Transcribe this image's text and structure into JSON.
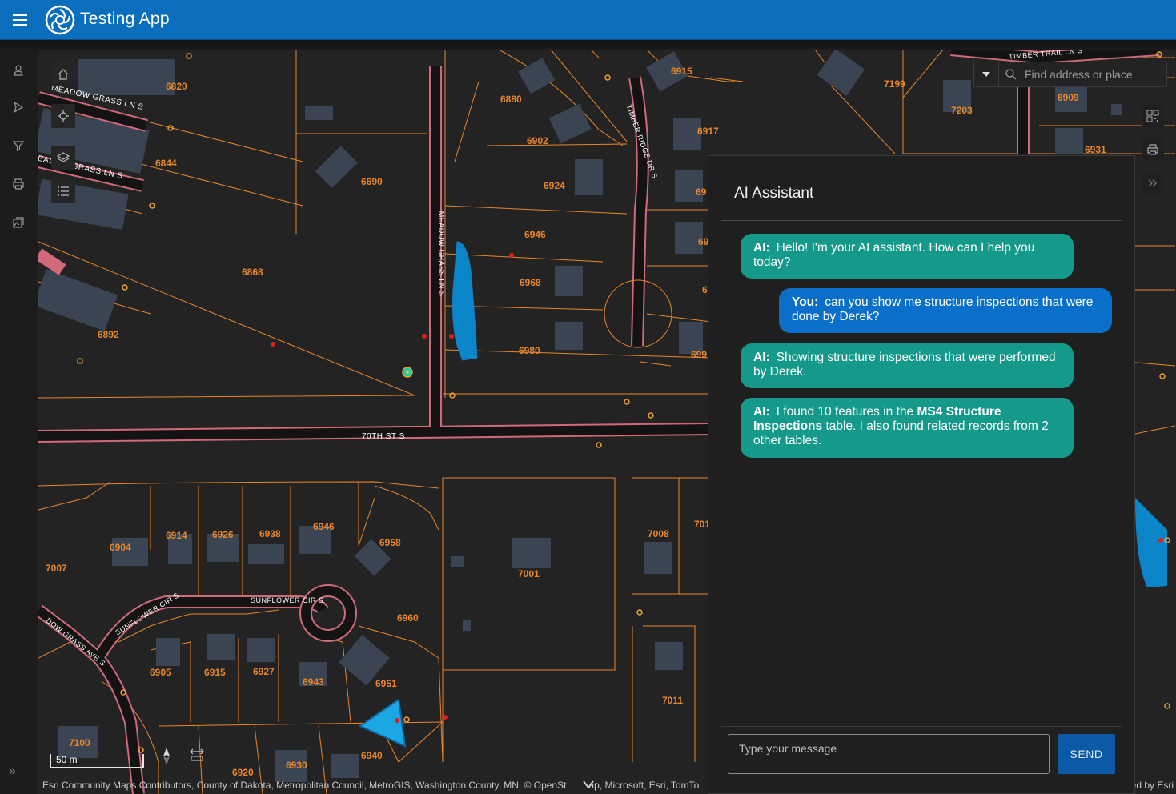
{
  "app": {
    "title": "Testing App"
  },
  "sidebar": {
    "items": [
      "user-icon",
      "navigate-icon",
      "filter-icon",
      "print-icon",
      "map-gallery-icon"
    ],
    "expand_label": "»"
  },
  "map": {
    "search_placeholder": "Find address or place",
    "scale_label": "50 m",
    "attribution": "Esri Community Maps Contributors, County of Dakota, Metropolitan Council, MetroGIS, Washington County, MN, © OpenSt",
    "attribution_tail": "ap, Microsoft, Esri, TomTo",
    "powered_by": "ed by Esri",
    "street_labels": [
      {
        "text": "MEADOW GRASS LN S"
      },
      {
        "text": "EADOW GRASS LN S"
      },
      {
        "text": "MEADOW GRASS LN S"
      },
      {
        "text": "70TH ST S"
      },
      {
        "text": "TIMBER RIDGE DR S"
      },
      {
        "text": "TIMBER TRAIL LN S"
      },
      {
        "text": "SUNFLOWER CIR S"
      },
      {
        "text": "SUNFLOWER CIR S"
      },
      {
        "text": "SUNFLOWER CIR S"
      },
      {
        "text": "DOW GRASS AVE S"
      }
    ],
    "parcel_labels": [
      "6820",
      "6844",
      "6880",
      "6902",
      "6915",
      "6917",
      "6924",
      "6946",
      "6968",
      "6980",
      "6690",
      "6868",
      "6892",
      "7199",
      "7203",
      "6909",
      "6931",
      "6904",
      "6914",
      "6926",
      "6938",
      "6946",
      "6958",
      "7001",
      "7008",
      "7007",
      "6960",
      "6905",
      "6915",
      "6927",
      "6943",
      "6951",
      "6940",
      "7100",
      "6920",
      "6930",
      "7011",
      "69",
      "69",
      "6",
      "699",
      "701"
    ]
  },
  "assistant": {
    "title": "AI Assistant",
    "messages": [
      {
        "role": "ai",
        "speaker": "AI:",
        "text": "Hello! I'm your AI assistant. How can I help you today?"
      },
      {
        "role": "you",
        "speaker": "You:",
        "text": "can you show me structure inspections that were done by Derek?"
      },
      {
        "role": "ai",
        "speaker": "AI:",
        "text": "Showing structure inspections that were performed by Derek."
      },
      {
        "role": "ai",
        "speaker": "AI:",
        "text_before": "I found 10 features in the ",
        "highlight": "MS4 Structure Inspections",
        "text_after": " table. I also found related records from 2 other tables."
      }
    ],
    "input_placeholder": "Type your message",
    "send_label": "SEND"
  },
  "colors": {
    "header": "#0a6ebd",
    "ai_bubble": "#14998a",
    "user_bubble": "#0a6fc8",
    "parcel_line": "#e8862a",
    "road": "#d06a7a",
    "building": "#3b4452",
    "water": "#0a86c8"
  }
}
